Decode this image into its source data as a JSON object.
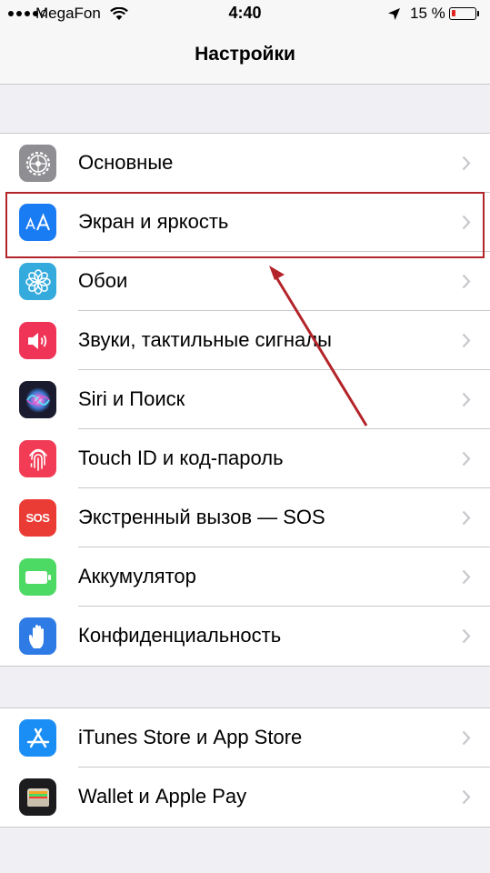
{
  "status_bar": {
    "carrier": "MegaFon",
    "time": "4:40",
    "battery_percent": "15 %",
    "battery_level": 0.15,
    "signal_bars_filled": 4
  },
  "nav": {
    "title": "Настройки"
  },
  "settings_group_1": [
    {
      "label": "Основные",
      "icon": "gear-icon",
      "color": "#8e8e93"
    },
    {
      "label": "Экран и яркость",
      "icon": "text-size-icon",
      "color": "#1a7cf2"
    },
    {
      "label": "Обои",
      "icon": "wallpaper-flower-icon",
      "color": "#35aadc"
    },
    {
      "label": "Звуки, тактильные сигналы",
      "icon": "speaker-icon",
      "color": "#f03457"
    },
    {
      "label": "Siri и Поиск",
      "icon": "siri-icon",
      "color": "#1b1b2f"
    },
    {
      "label": "Touch ID и код-пароль",
      "icon": "fingerprint-icon",
      "color": "#f23c55"
    },
    {
      "label": "Экстренный вызов — SOS",
      "icon": "sos-icon",
      "color": "#eb3b35",
      "icon_text": "SOS"
    },
    {
      "label": "Аккумулятор",
      "icon": "battery-icon",
      "color": "#4cd964"
    },
    {
      "label": "Конфиденциальность",
      "icon": "hand-icon",
      "color": "#2f7be5"
    }
  ],
  "settings_group_2": [
    {
      "label": "iTunes Store и App Store",
      "icon": "app-store-icon",
      "color": "#1b8ef5"
    },
    {
      "label": "Wallet и Apple Pay",
      "icon": "wallet-icon",
      "color": "#1c1c1e"
    }
  ],
  "annotation": {
    "highlight_color": "#b3242a"
  }
}
